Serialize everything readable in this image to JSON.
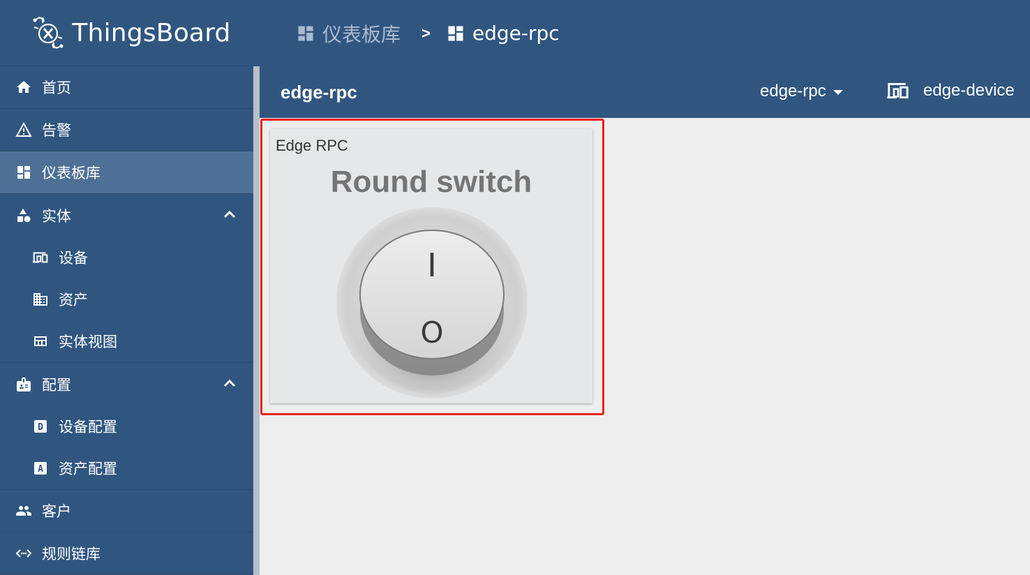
{
  "app": {
    "name": "ThingsBoard"
  },
  "sidebar": {
    "items": [
      {
        "label": "首页",
        "icon": "home-icon"
      },
      {
        "label": "告警",
        "icon": "warning-icon"
      },
      {
        "label": "仪表板库",
        "icon": "dashboard-icon",
        "active": true
      },
      {
        "label": "实体",
        "icon": "entities-icon",
        "expanded": true
      },
      {
        "label": "配置",
        "icon": "profiles-icon",
        "expanded": true
      },
      {
        "label": "客户",
        "icon": "customers-icon"
      },
      {
        "label": "规则链库",
        "icon": "rule-chain-icon"
      }
    ],
    "entities_sub": [
      {
        "label": "设备",
        "icon": "devices-icon"
      },
      {
        "label": "资产",
        "icon": "assets-icon"
      },
      {
        "label": "实体视图",
        "icon": "entity-view-icon"
      }
    ],
    "profiles_sub": [
      {
        "label": "设备配置",
        "icon": "device-profile-icon"
      },
      {
        "label": "资产配置",
        "icon": "asset-profile-icon"
      }
    ]
  },
  "breadcrumb": {
    "items": [
      "仪表板库",
      "edge-rpc"
    ],
    "separator": ">"
  },
  "dashboard": {
    "title": "edge-rpc",
    "state": "edge-rpc",
    "entity_alias": "edge-device"
  },
  "widget": {
    "title": "Edge RPC",
    "switch_title": "Round switch",
    "on_label": "I",
    "off_label": "O",
    "state": "off"
  },
  "colors": {
    "primary": "#305680",
    "active_item": "#4f7096",
    "highlight": "#e8231f",
    "content_bg": "#eeeeee"
  }
}
